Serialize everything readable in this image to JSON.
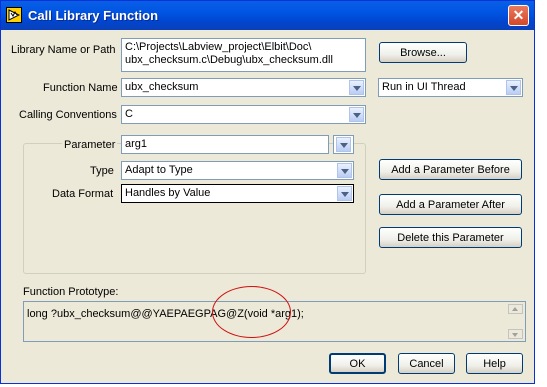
{
  "window": {
    "title": "Call Library Function",
    "close_symbol": "✕",
    "colors": {
      "titlebar": "#0054e3",
      "body": "#ece9d8",
      "annotation": "#d01010"
    }
  },
  "library": {
    "label": "Library Name or Path",
    "path_line1": "C:\\Projects\\Labview_project\\Elbit\\Doc\\",
    "path_line2": "ubx_checksum.c\\Debug\\ubx_checksum.dll",
    "browse_label": "Browse..."
  },
  "function": {
    "label": "Function Name",
    "value": "ubx_checksum",
    "thread_value": "Run in UI Thread"
  },
  "calling": {
    "label": "Calling Conventions",
    "value": "C"
  },
  "parameter": {
    "label": "Parameter",
    "value": "arg1",
    "type_label": "Type",
    "type_value": "Adapt to Type",
    "format_label": "Data Format",
    "format_value": "Handles by Value"
  },
  "param_buttons": {
    "add_before": "Add a Parameter Before",
    "add_after": "Add a Parameter After",
    "delete": "Delete this Parameter"
  },
  "prototype": {
    "label": "Function Prototype:",
    "text": "long ?ubx_checksum@@YAEPAEGPAG@Z(void *arg1);"
  },
  "footer": {
    "ok": "OK",
    "cancel": "Cancel",
    "help": "Help"
  }
}
